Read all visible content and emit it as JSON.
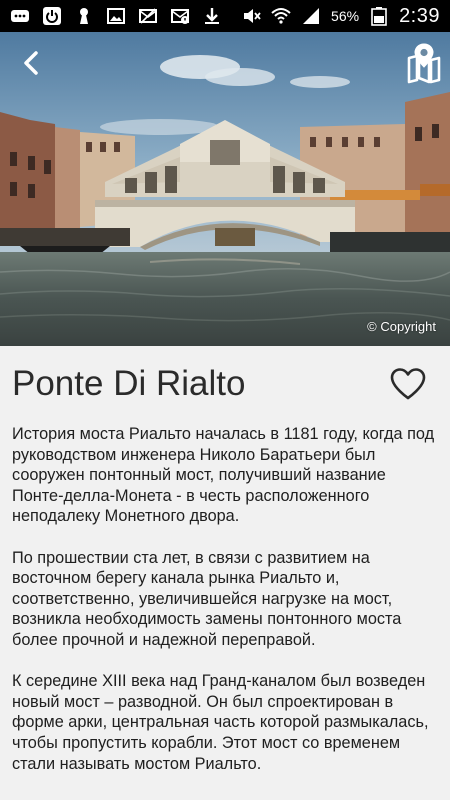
{
  "status_bar": {
    "battery": "56%",
    "time": "2:39",
    "left_icons": [
      "menu-dots-icon",
      "power-icon",
      "keyhole-icon",
      "image-icon",
      "mail-off-icon",
      "mail-alert-icon",
      "download-icon"
    ],
    "right_icons": [
      "mute-icon",
      "wifi-icon",
      "signal-icon",
      "battery-icon"
    ]
  },
  "hero": {
    "copyright": "© Copyright",
    "back_icon": "chevron-left-icon",
    "map_icon": "map-pin-icon"
  },
  "place": {
    "title": "Ponte Di Rialto",
    "favorite_icon": "heart-outline-icon",
    "paragraphs": [
      "История моста Риальто началась в 1181 году, когда под руководством инженера Николо Баратьери был сооружен понтонный мост, получивший название Понте-делла-Монета - в честь расположенного неподалеку Монетного двора.",
      "По прошествии ста лет, в связи с развитием на восточном берегу канала рынка Риальто и, соответственно, увеличившейся нагрузке на мост, возникла необходимость замены понтонного моста более прочной и надежной переправой.",
      "К середине XIII века над Гранд-каналом был возведен новый мост – разводной. Он был спроектирован в форме арки, центральная часть которой размыкалась, чтобы пропустить корабли. Этот мост со временем стали называть мостом Риальто."
    ]
  },
  "colors": {
    "background": "#f1f1f1",
    "text": "#202020",
    "title": "#2b2b2b",
    "status_bar": "#000000"
  }
}
